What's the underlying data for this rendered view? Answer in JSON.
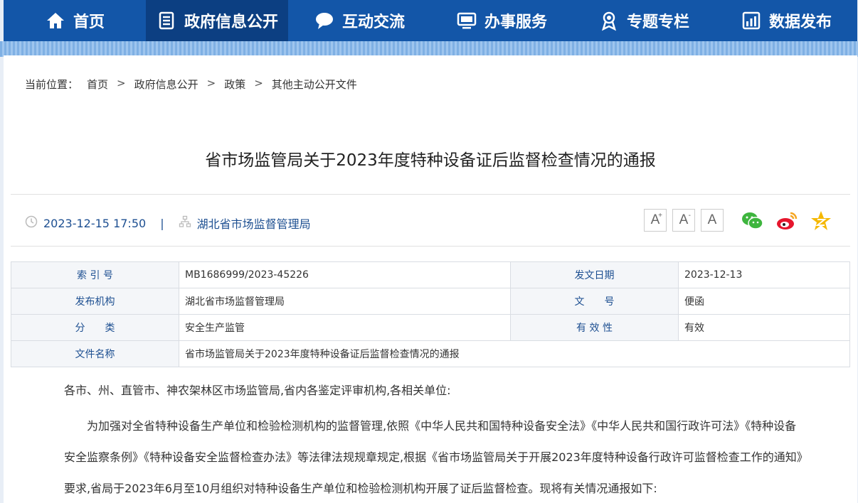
{
  "nav": {
    "items": [
      {
        "label": "首页",
        "icon": "home-icon",
        "active": false
      },
      {
        "label": "政府信息公开",
        "icon": "document-list-icon",
        "active": true
      },
      {
        "label": "互动交流",
        "icon": "chat-bubble-icon",
        "active": false
      },
      {
        "label": "办事服务",
        "icon": "monitor-icon",
        "active": false
      },
      {
        "label": "专题专栏",
        "icon": "award-icon",
        "active": false
      },
      {
        "label": "数据发布",
        "icon": "bar-chart-icon",
        "active": false
      }
    ]
  },
  "breadcrumb": {
    "prefix": "当前位置：",
    "items": [
      "首页",
      "政府信息公开",
      "政策",
      "其他主动公开文件"
    ],
    "separator": ">"
  },
  "article": {
    "title": "省市场监管局关于2023年度特种设备证后监督检查情况的通报",
    "datetime": "2023-12-15 17:50",
    "divider": "|",
    "publisher": "湖北省市场监督管理局"
  },
  "font_controls": {
    "increase": "A",
    "increase_mark": "+",
    "decrease": "A",
    "decrease_mark": "-",
    "reset": "A"
  },
  "share": [
    "wechat-icon",
    "weibo-icon",
    "qzone-icon"
  ],
  "info_table": {
    "index_label": "索 引 号",
    "index_value": "MB1686999/2023-45226",
    "date_label": "发文日期",
    "date_value": "2023-12-13",
    "org_label": "发布机构",
    "org_value": "湖北省市场监督管理局",
    "docno_label": "文　　号",
    "docno_value": "便函",
    "category_label": "分　　类",
    "category_value": "安全生产监管",
    "validity_label": "有 效 性",
    "validity_value": "有效",
    "filename_label": "文件名称",
    "filename_value": "省市场监管局关于2023年度特种设备证后监督检查情况的通报"
  },
  "body": {
    "salutation": "各市、州、直管市、神农架林区市场监管局,省内各鉴定评审机构,各相关单位:",
    "paragraph1": "为加强对全省特种设备生产单位和检验检测机构的监督管理,依照《中华人民共和国特种设备安全法》《中华人民共和国行政许可法》《特种设备安全监察条例》《特种设备安全监督检查办法》等法律法规规章规定,根据《省市场监管局关于开展2023年度特种设备行政许可监督检查工作的通知》要求,省局于2023年6月至10月组织对特种设备生产单位和检验检测机构开展了证后监督检查。现将有关情况通报如下:"
  }
}
